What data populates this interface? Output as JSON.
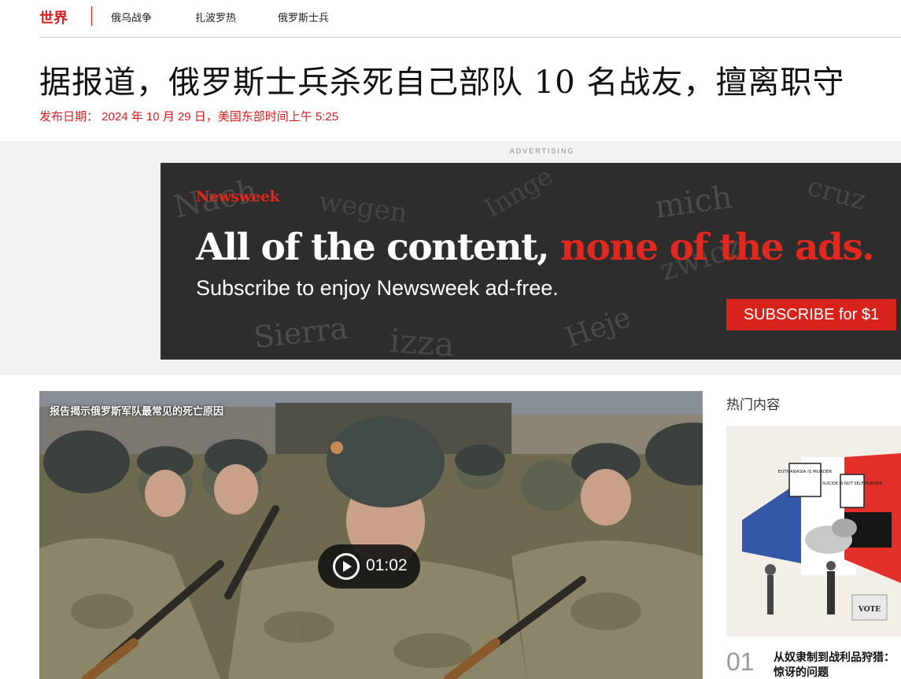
{
  "nav": {
    "section": "世界",
    "links": [
      "俄乌战争",
      "扎波罗热",
      "俄罗斯士兵"
    ]
  },
  "article": {
    "headline": "据报道，俄罗斯士兵杀死自己部队 10 名战友，擅离职守",
    "published": "发布日期： 2024 年 10 月 29 日，美国东部时间上午 5:25"
  },
  "ad": {
    "label": "ADVERTISING",
    "logo": "Newsweek",
    "headline_white": "All of the content, ",
    "headline_red": "none of the ads.",
    "subline": "Subscribe to enjoy Newsweek ad-free.",
    "cta": "SUBSCRIBE for $1",
    "background_words": [
      "Nach",
      "wegen",
      "Sierra",
      "izza",
      "Heje",
      "zwicz",
      "cruz",
      "mich",
      "Innge"
    ]
  },
  "video": {
    "title": "报告揭示俄罗斯军队最常见的死亡原因",
    "duration": "01:02",
    "play_icon": "play-circle-icon"
  },
  "trending": {
    "title": "热门内容",
    "items": [
      {
        "rank": "01",
        "headline": "从奴隶制到战利品狩猎：惊讶的问题"
      }
    ],
    "image_signs": [
      "EUTHANASIA IS MURDER",
      "SUICIDE IS NOT SELF-MURDER",
      "VOTE"
    ]
  },
  "colors": {
    "accent": "#d71e1e",
    "ad_background": "#2b2b2b",
    "ad_red": "#e0281f",
    "cta": "#d8231c"
  }
}
